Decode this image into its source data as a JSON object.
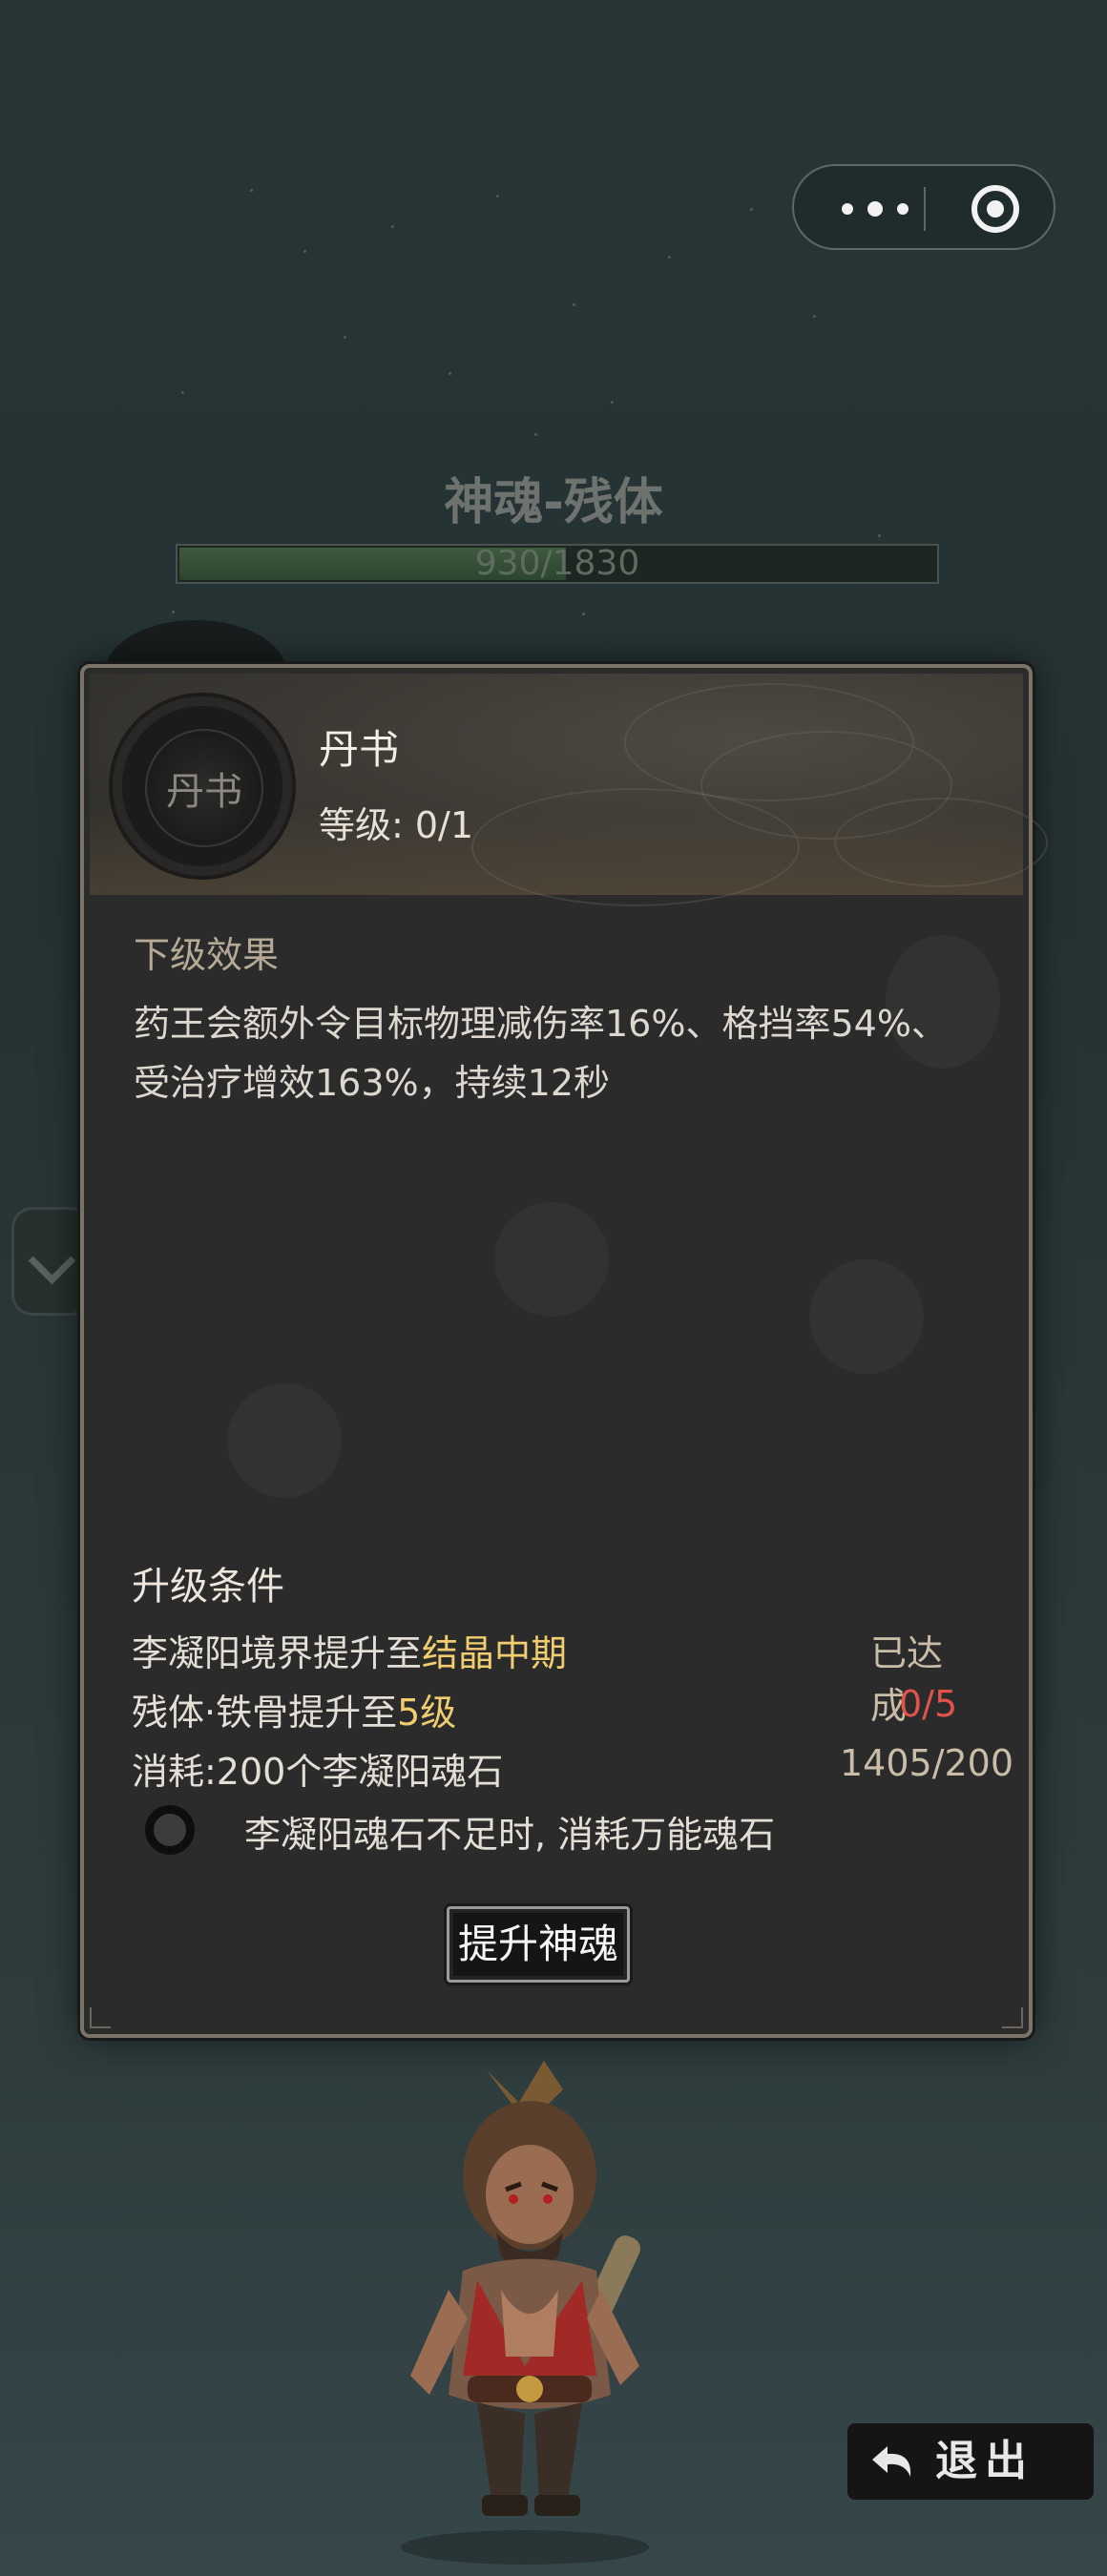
{
  "background": {
    "title": "神魂-残体",
    "progress_text": "930/1830",
    "progress_current": 930,
    "progress_max": 1830
  },
  "dialog": {
    "emblem_text": "丹书",
    "skill_name": "丹书",
    "level_text": "等级: 0/1",
    "effect_title": "下级效果",
    "effect_text": "药王会额外令目标物理减伤率16%、格挡率54%、受治疗增效163%，持续12秒",
    "requirements_title": "升级条件",
    "requirements": [
      {
        "prefix": "李凝阳境界提升至",
        "highlight": "结晶中期",
        "status": "已达成",
        "status_color": "ok"
      },
      {
        "prefix": "残体·铁骨提升至",
        "highlight": "5级",
        "status": "0/5",
        "status_color": "red"
      },
      {
        "prefix": "消耗:200个李凝阳魂石",
        "highlight": "",
        "status": "1405/200",
        "status_color": "ok"
      }
    ],
    "toggle_label": "李凝阳魂石不足时, 消耗万能魂石",
    "upgrade_button": "提升神魂"
  },
  "exit_button": "退出",
  "colors": {
    "highlight": "#f0cd6e",
    "not_met": "#e0534b",
    "met": "#c9bda8"
  }
}
